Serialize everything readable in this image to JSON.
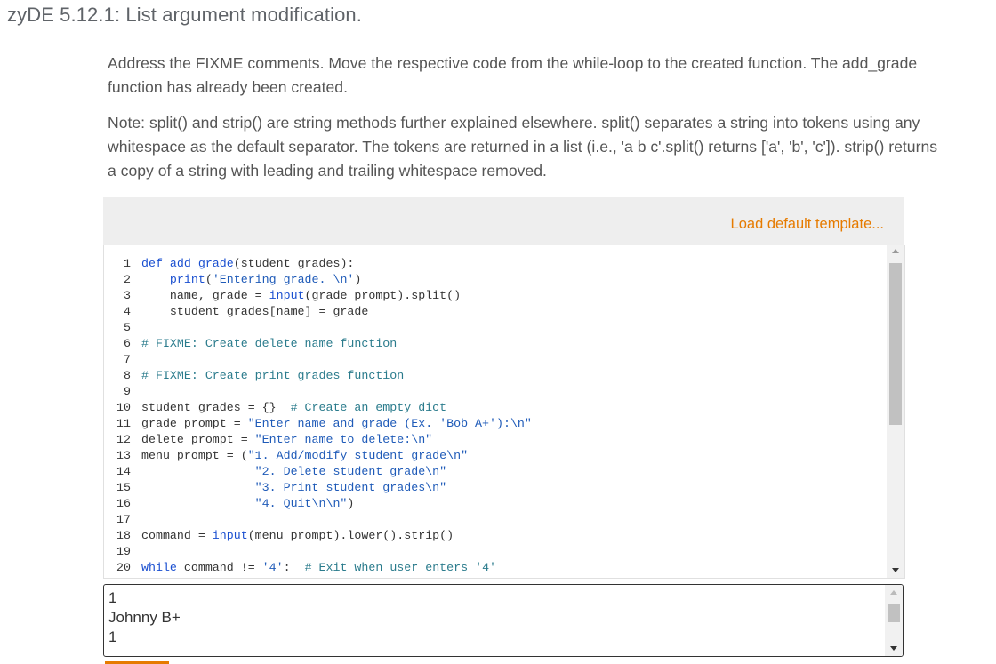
{
  "title": "zyDE 5.12.1: List argument modification.",
  "paragraphs": [
    "Address the FIXME comments. Move the respective code from the while-loop to the created function. The add_grade function has already been created.",
    "Note: split() and strip() are string methods further explained elsewhere. split() separates a string into tokens using any whitespace as the default separator. The tokens are returned in a list (i.e., 'a b c'.split() returns ['a', 'b', 'c']). strip() returns a copy of a string with leading and trailing whitespace removed."
  ],
  "toolbar": {
    "load_label": "Load default template..."
  },
  "code_lines": [
    {
      "n": "1",
      "segs": [
        [
          "kw",
          "def "
        ],
        [
          "fn",
          "add_grade"
        ],
        [
          "lc",
          "(student_grades):"
        ]
      ]
    },
    {
      "n": "2",
      "segs": [
        [
          "lc",
          "    "
        ],
        [
          "fn",
          "print"
        ],
        [
          "lc",
          "("
        ],
        [
          "str",
          "'Entering grade. \\n'"
        ],
        [
          "lc",
          ")"
        ]
      ]
    },
    {
      "n": "3",
      "segs": [
        [
          "lc",
          "    name, grade = "
        ],
        [
          "fn",
          "input"
        ],
        [
          "lc",
          "(grade_prompt).split()"
        ]
      ]
    },
    {
      "n": "4",
      "segs": [
        [
          "lc",
          "    student_grades[name] = grade"
        ]
      ]
    },
    {
      "n": "5",
      "segs": []
    },
    {
      "n": "6",
      "segs": [
        [
          "com",
          "# FIXME: Create delete_name function"
        ]
      ]
    },
    {
      "n": "7",
      "segs": []
    },
    {
      "n": "8",
      "segs": [
        [
          "com",
          "# FIXME: Create print_grades function"
        ]
      ]
    },
    {
      "n": "9",
      "segs": []
    },
    {
      "n": "10",
      "segs": [
        [
          "lc",
          "student_grades = {}  "
        ],
        [
          "com",
          "# Create an empty dict"
        ]
      ]
    },
    {
      "n": "11",
      "segs": [
        [
          "lc",
          "grade_prompt = "
        ],
        [
          "str",
          "\"Enter name and grade (Ex. 'Bob A+'):\\n\""
        ]
      ]
    },
    {
      "n": "12",
      "segs": [
        [
          "lc",
          "delete_prompt = "
        ],
        [
          "str",
          "\"Enter name to delete:\\n\""
        ]
      ]
    },
    {
      "n": "13",
      "segs": [
        [
          "lc",
          "menu_prompt = ("
        ],
        [
          "str",
          "\"1. Add/modify student grade\\n\""
        ]
      ]
    },
    {
      "n": "14",
      "segs": [
        [
          "lc",
          "                "
        ],
        [
          "str",
          "\"2. Delete student grade\\n\""
        ]
      ]
    },
    {
      "n": "15",
      "segs": [
        [
          "lc",
          "                "
        ],
        [
          "str",
          "\"3. Print student grades\\n\""
        ]
      ]
    },
    {
      "n": "16",
      "segs": [
        [
          "lc",
          "                "
        ],
        [
          "str",
          "\"4. Quit\\n\\n\""
        ],
        [
          "lc",
          ")"
        ]
      ]
    },
    {
      "n": "17",
      "segs": []
    },
    {
      "n": "18",
      "segs": [
        [
          "lc",
          "command = "
        ],
        [
          "fn",
          "input"
        ],
        [
          "lc",
          "(menu_prompt).lower().strip()"
        ]
      ]
    },
    {
      "n": "19",
      "segs": []
    },
    {
      "n": "20",
      "segs": [
        [
          "kw",
          "while"
        ],
        [
          "lc",
          " command != "
        ],
        [
          "str",
          "'4'"
        ],
        [
          "lc",
          ":  "
        ],
        [
          "com",
          "# Exit when user enters '4'"
        ]
      ]
    }
  ],
  "input_lines": [
    "1",
    "Johnny B+",
    "1"
  ],
  "colors": {
    "accent": "#e67b00",
    "keyword": "#1a4fd0",
    "string": "#1e5ab8",
    "comment": "#2a7b8c"
  }
}
